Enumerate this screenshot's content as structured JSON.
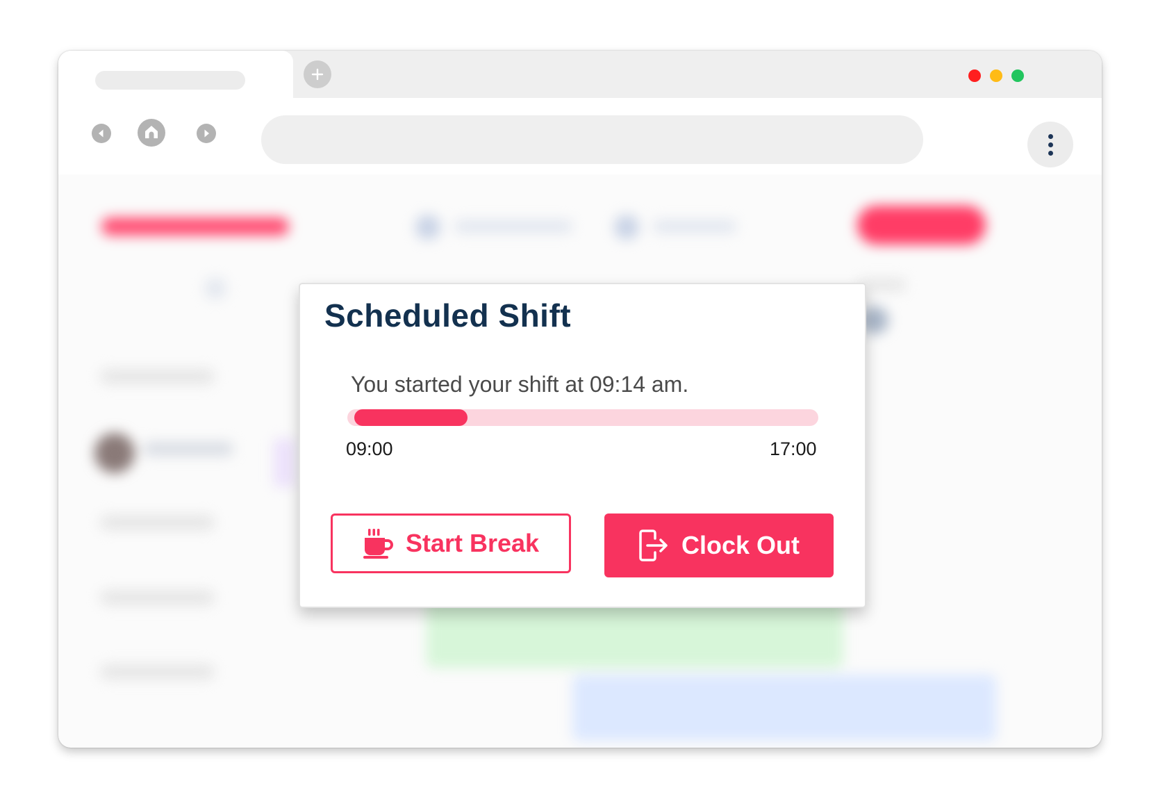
{
  "browser": {
    "window_controls": {
      "close_color": "#ff1f1f",
      "minimize_color": "#ffbb16",
      "maximize_color": "#22c55e"
    },
    "icons": {
      "new_tab": "plus-icon",
      "back": "back-icon",
      "home": "home-icon",
      "forward": "forward-icon",
      "menu": "more-vertical-icon"
    }
  },
  "modal": {
    "title": "Scheduled Shift",
    "shift_message": "You started your shift at 09:14 am.",
    "progress": {
      "start_label": "09:00",
      "end_label": "17:00",
      "fraction": 0.24,
      "fill_color": "#f8335f",
      "track_color": "#fcd5de"
    },
    "start_break": {
      "label": "Start Break",
      "icon": "coffee-cup-icon"
    },
    "clock_out": {
      "label": "Clock Out",
      "icon": "sign-out-icon"
    }
  },
  "colors": {
    "accent": "#f8335f",
    "title": "#13314f"
  }
}
